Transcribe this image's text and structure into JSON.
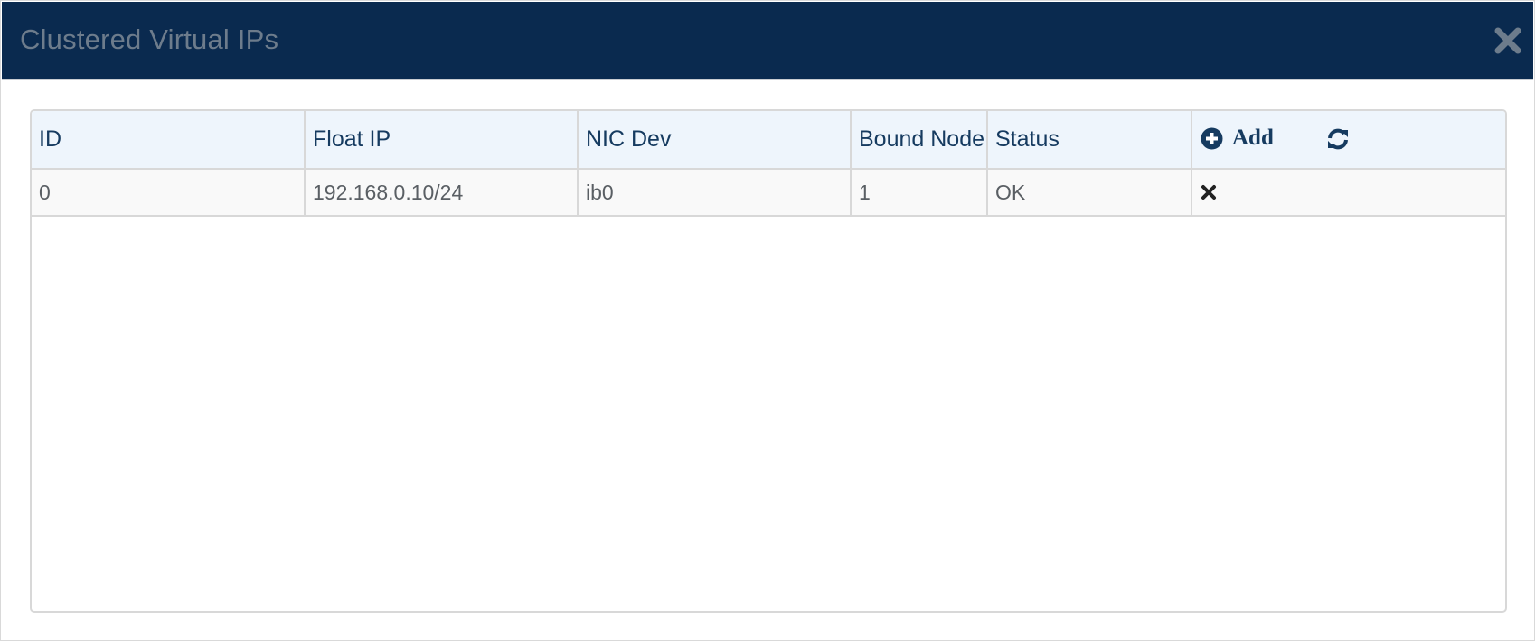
{
  "dialog": {
    "title": "Clustered Virtual IPs",
    "close_icon": "close-icon"
  },
  "table": {
    "columns": [
      "ID",
      "Float IP",
      "NIC Dev",
      "Bound Node",
      "Status"
    ],
    "add_label": "Add",
    "rows": [
      {
        "id": "0",
        "float_ip": "192.168.0.10/24",
        "nic_dev": "ib0",
        "bound_node": "1",
        "status": "OK"
      }
    ]
  },
  "icons": {
    "add": "plus-circle-icon",
    "refresh": "refresh-icon",
    "delete": "delete-icon"
  },
  "colors": {
    "header_bg": "#0a2a4f",
    "title_text": "#6d7c8c",
    "table_header_bg": "#eef5fc",
    "table_header_text": "#163b60",
    "row_bg": "#f9f9f9"
  }
}
